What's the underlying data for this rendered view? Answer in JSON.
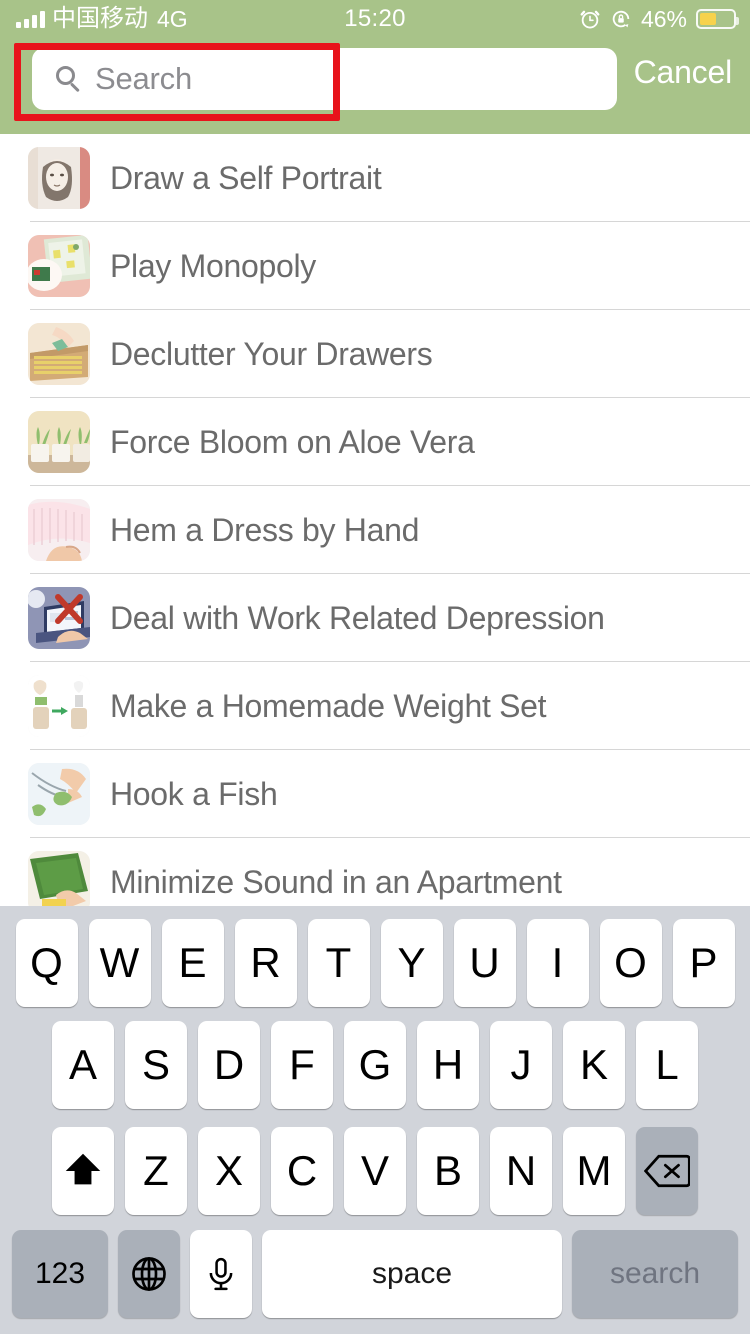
{
  "status_bar": {
    "carrier": "中国移动",
    "network": "4G",
    "time": "15:20",
    "battery_percent": "46%",
    "signal_bars": 4,
    "icons": [
      "signal-bars-icon",
      "alarm-clock-icon",
      "rotation-lock-icon",
      "battery-icon"
    ],
    "battery_color": "#f7d24c",
    "text_color": "#ffffff"
  },
  "header": {
    "background_color": "#a8c389",
    "cancel_label": "Cancel",
    "annotation_color": "#e8131b"
  },
  "search": {
    "placeholder": "Search",
    "value": "",
    "icon": "search-icon"
  },
  "list": {
    "items": [
      {
        "title": "Draw a Self Portrait",
        "thumb": "self-portrait-sketch-thumbnail"
      },
      {
        "title": "Play Monopoly",
        "thumb": "monopoly-board-thumbnail"
      },
      {
        "title": "Declutter Your Drawers",
        "thumb": "drawer-organizing-thumbnail"
      },
      {
        "title": "Force Bloom on Aloe Vera",
        "thumb": "potted-aloe-plants-thumbnail"
      },
      {
        "title": "Hem a Dress by Hand",
        "thumb": "hand-sewing-dress-thumbnail"
      },
      {
        "title": "Deal with Work Related Depression",
        "thumb": "laptop-red-x-thumbnail"
      },
      {
        "title": "Make a Homemade Weight Set",
        "thumb": "homemade-weights-thumbnail"
      },
      {
        "title": "Hook a Fish",
        "thumb": "fishing-hook-thumbnail"
      },
      {
        "title": "Minimize Sound in an Apartment",
        "thumb": "soundproof-panel-thumbnail"
      }
    ]
  },
  "keyboard": {
    "background_color": "#d1d4da",
    "row1": [
      "Q",
      "W",
      "E",
      "R",
      "T",
      "Y",
      "U",
      "I",
      "O",
      "P"
    ],
    "row2": [
      "A",
      "S",
      "D",
      "F",
      "G",
      "H",
      "J",
      "K",
      "L"
    ],
    "row3": [
      "Z",
      "X",
      "C",
      "V",
      "B",
      "N",
      "M"
    ],
    "shift_key": "shift-icon",
    "backspace_key": "backspace-icon",
    "numbers_key": "123",
    "globe_key": "globe-icon",
    "dictation_key": "microphone-icon",
    "space_key": "space",
    "return_key": "search"
  }
}
